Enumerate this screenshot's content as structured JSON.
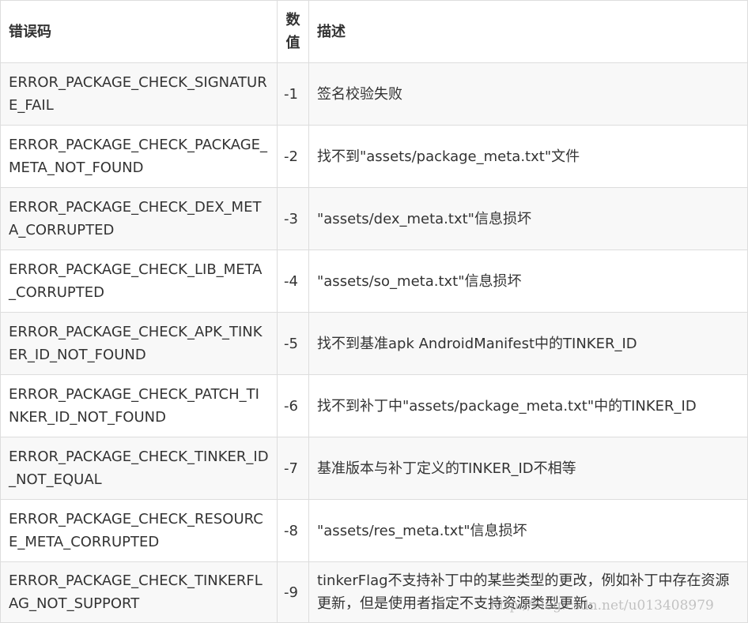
{
  "table": {
    "headers": {
      "code": "错误码",
      "value": "数值",
      "description": "描述"
    },
    "rows": [
      {
        "code": "ERROR_PACKAGE_CHECK_SIGNATURE_FAIL",
        "value": "-1",
        "description": "签名校验失败"
      },
      {
        "code": "ERROR_PACKAGE_CHECK_PACKAGE_META_NOT_FOUND",
        "value": "-2",
        "description": "找不到\"assets/package_meta.txt\"文件"
      },
      {
        "code": "ERROR_PACKAGE_CHECK_DEX_META_CORRUPTED",
        "value": "-3",
        "description": "\"assets/dex_meta.txt\"信息损坏"
      },
      {
        "code": "ERROR_PACKAGE_CHECK_LIB_META_CORRUPTED",
        "value": "-4",
        "description": "\"assets/so_meta.txt\"信息损坏"
      },
      {
        "code": "ERROR_PACKAGE_CHECK_APK_TINKER_ID_NOT_FOUND",
        "value": "-5",
        "description": "找不到基准apk AndroidManifest中的TINKER_ID"
      },
      {
        "code": "ERROR_PACKAGE_CHECK_PATCH_TINKER_ID_NOT_FOUND",
        "value": "-6",
        "description": "找不到补丁中\"assets/package_meta.txt\"中的TINKER_ID"
      },
      {
        "code": "ERROR_PACKAGE_CHECK_TINKER_ID_NOT_EQUAL",
        "value": "-7",
        "description": "基准版本与补丁定义的TINKER_ID不相等"
      },
      {
        "code": "ERROR_PACKAGE_CHECK_RESOURCE_META_CORRUPTED",
        "value": "-8",
        "description": "\"assets/res_meta.txt\"信息损坏"
      },
      {
        "code": "ERROR_PACKAGE_CHECK_TINKERFLAG_NOT_SUPPORT",
        "value": "-9",
        "description": "tinkerFlag不支持补丁中的某些类型的更改，例如补丁中存在资源更新，但是使用者指定不支持资源类型更新。"
      }
    ]
  },
  "watermark": "http://blog.csdn.net/u013408979"
}
